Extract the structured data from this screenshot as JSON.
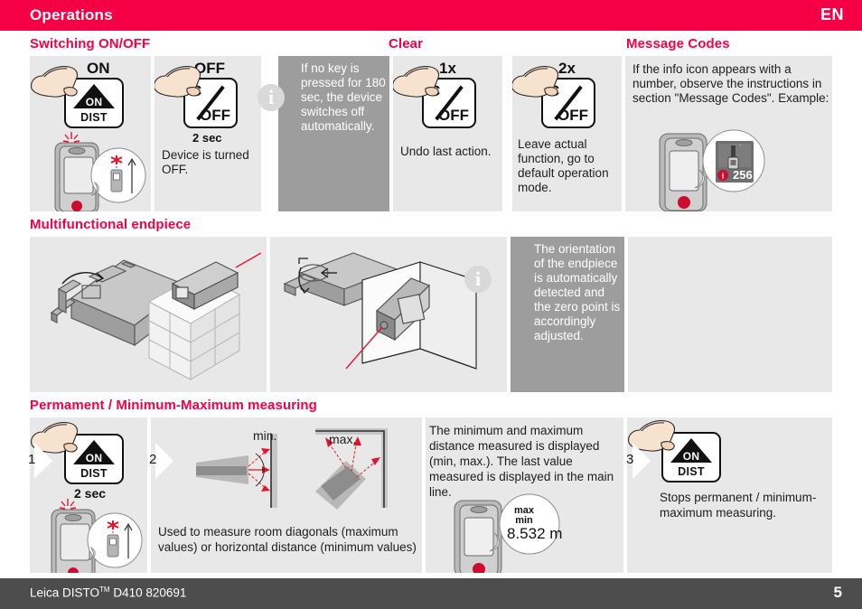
{
  "header": {
    "title": "Operations",
    "language": "EN"
  },
  "sections": [
    {
      "id": "switching",
      "title": "Switching ON/OFF"
    },
    {
      "id": "clear",
      "title": "Clear"
    },
    {
      "id": "message_codes",
      "title": "Message Codes"
    },
    {
      "id": "endpiece",
      "title": "Multifunctional endpiece"
    },
    {
      "id": "permanent",
      "title": "Permament / Minimum-Maximum measuring"
    }
  ],
  "row1": {
    "panel_on": {
      "key_label": "ON",
      "key_glyph_top": "ON",
      "key_glyph_bottom": "DIST",
      "icon": "device-laser-on"
    },
    "panel_off": {
      "key_label": "OFF",
      "key_glyph_c": "C",
      "key_glyph_off": "OFF",
      "hold_time": "2 sec",
      "caption": "Device is turned OFF."
    },
    "panel_info": {
      "icon": "info-icon",
      "text": "If no key is pressed for 180 sec, the device switches off automatically."
    },
    "panel_clear1x": {
      "key_label": "1x",
      "key_glyph_c": "C",
      "key_glyph_off": "OFF",
      "caption": "Undo last action."
    },
    "panel_clear2x": {
      "key_label": "2x",
      "key_glyph_c": "C",
      "key_glyph_off": "OFF",
      "caption": "Leave actual function, go to default operation mode."
    },
    "panel_msgcodes": {
      "text": "If the info icon appears with a number, observe the instructions in section \"Message Codes\". Example:",
      "display_code": "256",
      "display_icon": "info-warning-icon"
    }
  },
  "row2": {
    "panel_a": {
      "icon": "endpiece-flip-illustration"
    },
    "panel_b": {
      "icon": "device-on-wall-illustration"
    },
    "panel_c": {
      "icon": "device-in-corner-illustration"
    },
    "panel_info": {
      "icon": "info-icon",
      "text": "The orientation of the endpiece is automatically detected and the zero point is accordingly adjusted."
    }
  },
  "row3": {
    "step1": {
      "number": "1",
      "key_glyph_top": "ON",
      "key_glyph_bottom": "DIST",
      "hold_time": "2 sec",
      "icon": "device-laser-on"
    },
    "step2": {
      "number": "2",
      "label_min": "min.",
      "label_max": "max.",
      "caption": "Used to measure room diagonals (maximum values) or horizontal distance (minimum values)"
    },
    "info": {
      "text": "The minimum and maximum distance measured is displayed (min, max.). The last value measured is displayed in the main line.",
      "display_max": "max",
      "display_min": "min",
      "display_value": "8.532 m"
    },
    "step3": {
      "number": "3",
      "key_glyph_top": "ON",
      "key_glyph_bottom": "DIST",
      "caption": "Stops permanent / minimum-maximum measuring."
    }
  },
  "footer": {
    "text_before_sup": "Leica DISTO",
    "sup": "TM",
    "text_after_sup": " D410 820691",
    "page_number": "5"
  },
  "colors": {
    "brand_red": "#f50045",
    "panel_grey": "#e8e8e8",
    "info_grey": "#9d9d9d",
    "footer_grey": "#4d4d4d",
    "laser_red": "#e8132b"
  }
}
